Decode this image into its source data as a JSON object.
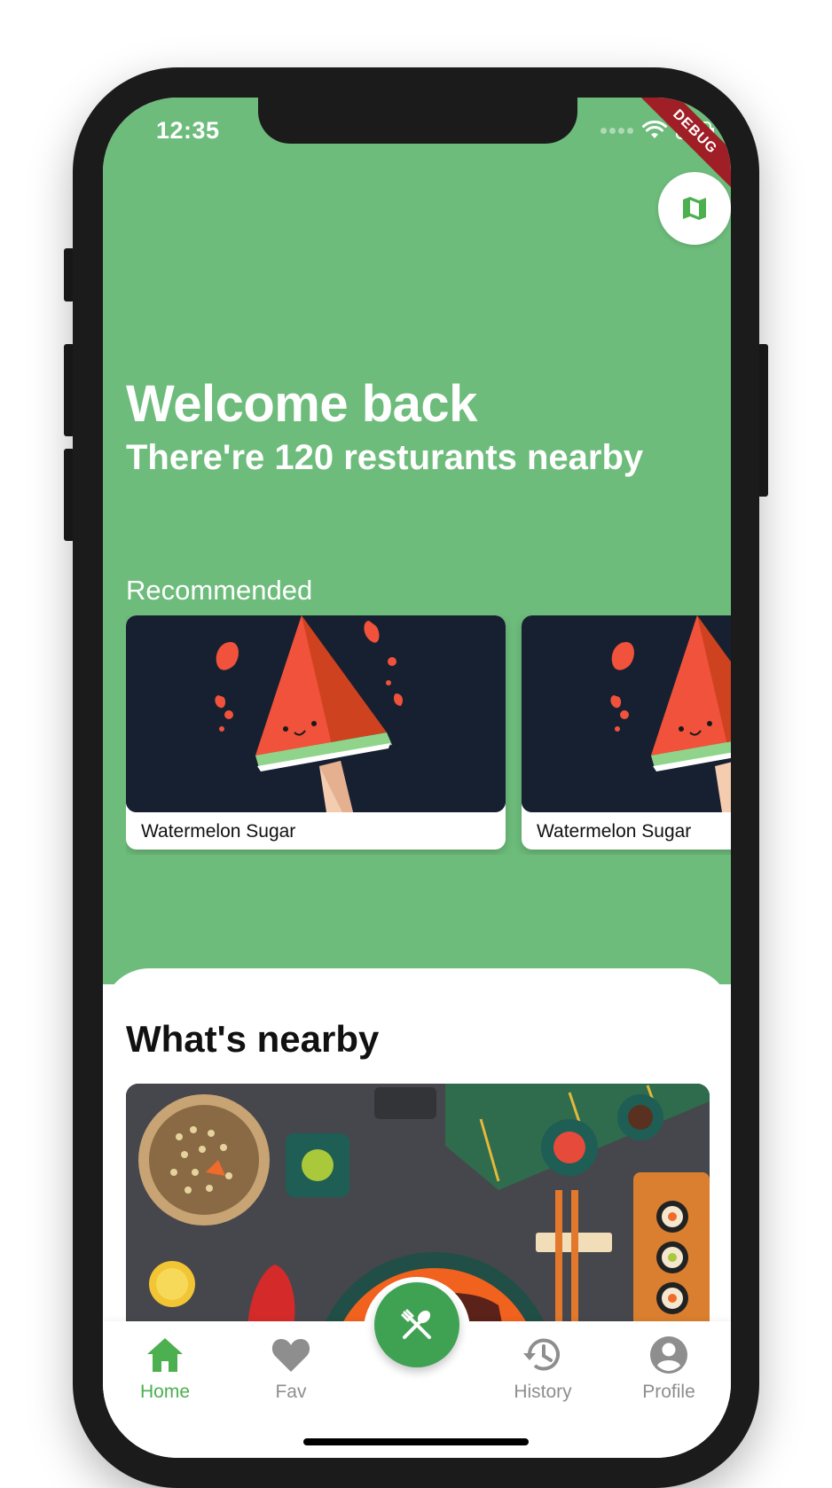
{
  "status_bar": {
    "time": "12:35",
    "debug_banner": "DEBUG"
  },
  "header": {
    "map_button_icon": "map-icon",
    "welcome_title": "Welcome back",
    "welcome_subtitle": "There're 120 resturants nearby"
  },
  "recommended": {
    "label": "Recommended",
    "items": [
      {
        "name": "Watermelon Sugar",
        "image_icon": "watermelon-popsicle-illustration"
      },
      {
        "name": "Watermelon Sugar",
        "image_icon": "watermelon-popsicle-illustration"
      }
    ]
  },
  "nearby": {
    "title": "What's nearby",
    "image_icon": "japanese-food-table-illustration"
  },
  "bottom_nav": {
    "items": [
      {
        "label": "Home",
        "icon": "home-icon",
        "active": true
      },
      {
        "label": "Fav",
        "icon": "heart-icon",
        "active": false
      },
      {
        "label": "History",
        "icon": "history-icon",
        "active": false
      },
      {
        "label": "Profile",
        "icon": "profile-icon",
        "active": false
      }
    ],
    "fab_icon": "utensils-icon"
  },
  "colors": {
    "hero_green": "#6dbc7b",
    "accent_green": "#4caf50",
    "fab_green": "#3fa253",
    "inactive_gray": "#8e8e8e",
    "card_dark": "#172031",
    "debug_red": "#a01f27"
  }
}
